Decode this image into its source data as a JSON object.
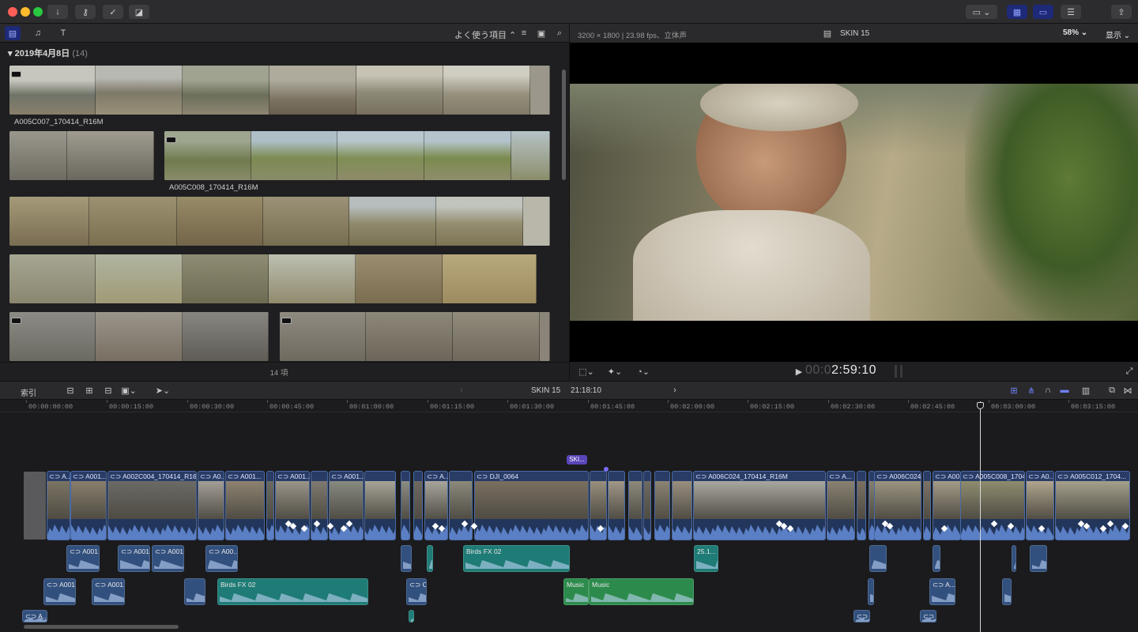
{
  "titlebar": {
    "traffic": [
      "#ff5f57",
      "#febc2e",
      "#28c840"
    ],
    "buttons": [
      "download-icon",
      "key-icon",
      "checkmark-icon",
      "tag-icon"
    ],
    "right_buttons": [
      "layout-icon",
      "browser-toggle-icon",
      "timeline-toggle-icon",
      "inspector-toggle-icon",
      "share-icon"
    ]
  },
  "browser": {
    "filter_label": "よく使う項目",
    "date_header": "2019年4月8日",
    "date_count": "(14)",
    "clip1_name": "A005C007_170414_R16M",
    "clip2_name": "A005C008_170414_R16M",
    "footer": "14 項"
  },
  "viewer": {
    "info": "3200 × 1800 | 23.98 fps、立体声",
    "project": "SKIN 15",
    "zoom": "58%",
    "display_label": "显示",
    "timecode_dim": "00:0",
    "timecode": "2:59:10"
  },
  "timeline": {
    "index_label": "索引",
    "project": "SKIN 15",
    "duration": "21:18:10",
    "ruler": [
      "00:00:00:00",
      "00:00:15:00",
      "00:00:30:00",
      "00:00:45:00",
      "00:01:00:00",
      "00:01:15:00",
      "00:01:30:00",
      "00:01:45:00",
      "00:02:00:00",
      "00:02:15:00",
      "00:02:30:00",
      "00:02:45:00",
      "00:03:00:00",
      "00:03:15:00"
    ],
    "marker_label": "SKI...",
    "primary_clips": [
      {
        "name": "A..."
      },
      {
        "name": "A001..."
      },
      {
        "name": "A002C004_170414_R16M"
      },
      {
        "name": "A0..."
      },
      {
        "name": "A001..."
      },
      {
        "name": "A001..."
      },
      {
        "name": "A001..."
      },
      {
        "name": "A..."
      },
      {
        "name": "DJI_0064"
      },
      {
        "name": "A006C024_170414_R16M"
      },
      {
        "name": "A..."
      },
      {
        "name": "A006C024..."
      },
      {
        "name": "A00..."
      },
      {
        "name": "A005C008_1704..."
      },
      {
        "name": "A0..."
      },
      {
        "name": "A005C012_1704..."
      }
    ],
    "audio_clips": [
      {
        "name": "A001..."
      },
      {
        "name": "A001..."
      },
      {
        "name": "A001..."
      },
      {
        "name": "A00..."
      },
      {
        "name": "Birds FX 02"
      },
      {
        "name": "25.1..."
      },
      {
        "name": "A001..."
      },
      {
        "name": "A001..."
      },
      {
        "name": "Birds FX 02"
      },
      {
        "name": "Car..."
      },
      {
        "name": "Music"
      },
      {
        "name": "Music"
      },
      {
        "name": "A..."
      },
      {
        "name": "A..."
      },
      {
        "name": "A"
      },
      {
        "name": "A"
      }
    ]
  }
}
